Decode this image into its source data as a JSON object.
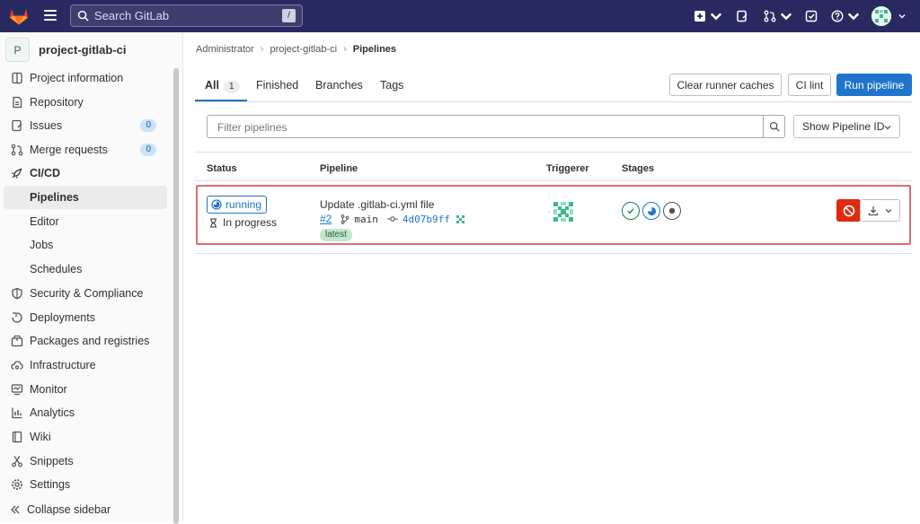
{
  "topbar": {
    "search_placeholder": "Search GitLab",
    "search_shortcut": "/"
  },
  "sidebar": {
    "project_avatar_letter": "P",
    "project_name": "project-gitlab-ci",
    "items": [
      {
        "label": "Project information",
        "icon": "project-info-icon"
      },
      {
        "label": "Repository",
        "icon": "repository-icon"
      },
      {
        "label": "Issues",
        "icon": "issues-icon",
        "badge": "0"
      },
      {
        "label": "Merge requests",
        "icon": "merge-request-icon",
        "badge": "0"
      },
      {
        "label": "CI/CD",
        "icon": "rocket-icon"
      },
      {
        "label": "Pipelines",
        "sub": true,
        "active": true
      },
      {
        "label": "Editor",
        "sub": true
      },
      {
        "label": "Jobs",
        "sub": true
      },
      {
        "label": "Schedules",
        "sub": true
      },
      {
        "label": "Security & Compliance",
        "icon": "shield-icon"
      },
      {
        "label": "Deployments",
        "icon": "deployments-icon"
      },
      {
        "label": "Packages and registries",
        "icon": "package-icon"
      },
      {
        "label": "Infrastructure",
        "icon": "cloud-gear-icon"
      },
      {
        "label": "Monitor",
        "icon": "monitor-icon"
      },
      {
        "label": "Analytics",
        "icon": "chart-icon"
      },
      {
        "label": "Wiki",
        "icon": "book-icon"
      },
      {
        "label": "Snippets",
        "icon": "scissors-icon"
      },
      {
        "label": "Settings",
        "icon": "gear-icon"
      }
    ],
    "collapse_label": "Collapse sidebar"
  },
  "breadcrumb": {
    "items": [
      "Administrator",
      "project-gitlab-ci",
      "Pipelines"
    ]
  },
  "tabs": {
    "all": "All",
    "all_count": "1",
    "finished": "Finished",
    "branches": "Branches",
    "tags": "Tags"
  },
  "actions": {
    "clear_caches": "Clear runner caches",
    "ci_lint": "CI lint",
    "run_pipeline": "Run pipeline"
  },
  "filter": {
    "placeholder": "Filter pipelines",
    "id_select": "Show Pipeline ID"
  },
  "table": {
    "headers": [
      "Status",
      "Pipeline",
      "Triggerer",
      "Stages"
    ],
    "rows": [
      {
        "status": "running",
        "status_detail": "In progress",
        "title": "Update .gitlab-ci.yml file",
        "id": "#2",
        "branch": "main",
        "commit": "4d07b9ff",
        "tag": "latest",
        "stages": [
          "success",
          "running",
          "created"
        ]
      }
    ]
  },
  "colors": {
    "topbar": "#292961",
    "primary": "#1f75cb",
    "danger": "#dd2b0e",
    "success": "#108548",
    "highlight_border": "#e06a6a"
  }
}
